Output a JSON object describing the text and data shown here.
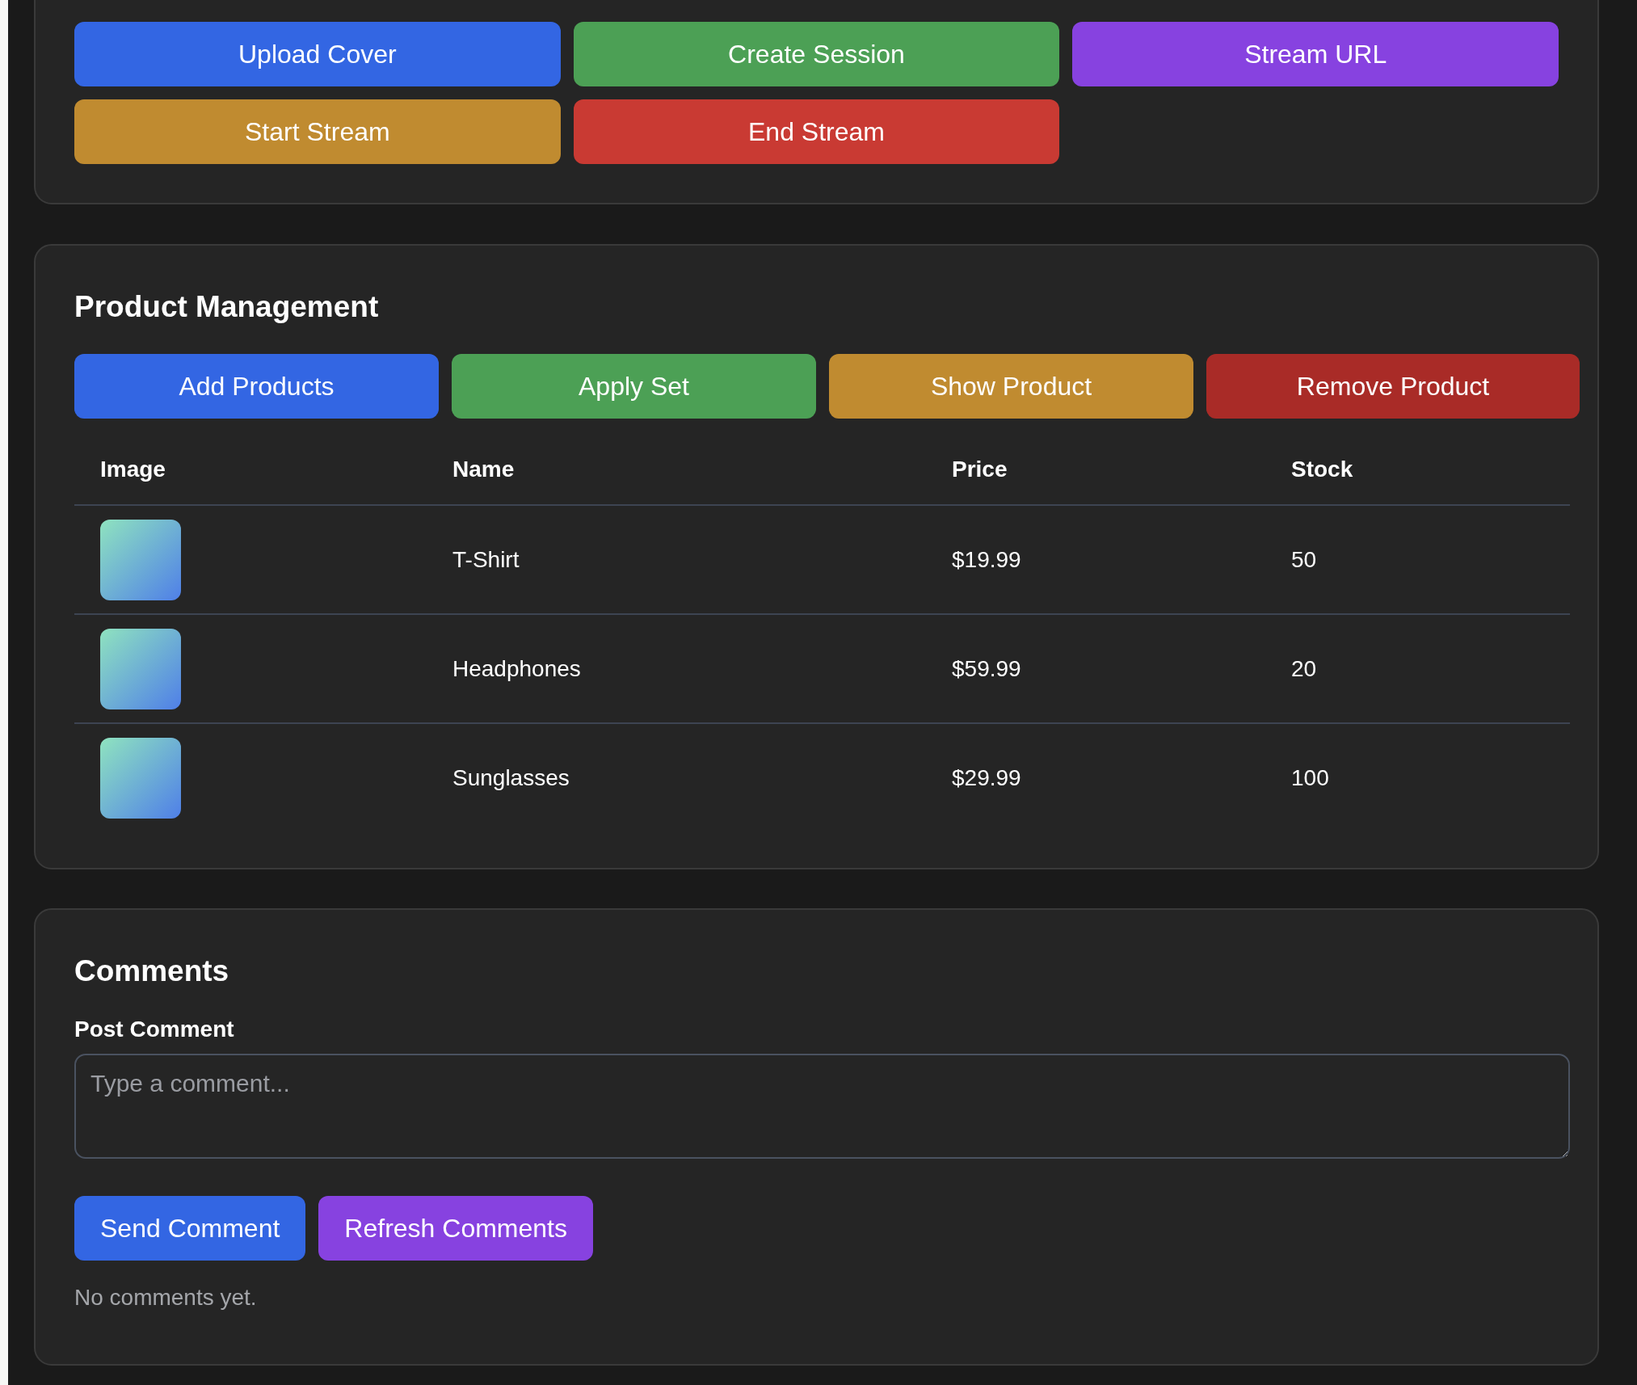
{
  "stream_controls": {
    "buttons": [
      {
        "label": "Upload Cover",
        "color": "#3366e3"
      },
      {
        "label": "Create Session",
        "color": "#4ca055"
      },
      {
        "label": "Stream URL",
        "color": "#8742e0"
      },
      {
        "label": "Start Stream",
        "color": "#c08b30"
      },
      {
        "label": "End Stream",
        "color": "#c93a33"
      }
    ]
  },
  "product_management": {
    "title": "Product Management",
    "buttons": [
      {
        "label": "Add Products",
        "color": "#3366e3"
      },
      {
        "label": "Apply Set",
        "color": "#4ca055"
      },
      {
        "label": "Show Product",
        "color": "#c08b30"
      },
      {
        "label": "Remove Product",
        "color": "#a92b27"
      }
    ],
    "table": {
      "columns": [
        "Image",
        "Name",
        "Price",
        "Stock"
      ],
      "rows": [
        {
          "name": "T-Shirt",
          "price": "$19.99",
          "stock": "50"
        },
        {
          "name": "Headphones",
          "price": "$59.99",
          "stock": "20"
        },
        {
          "name": "Sunglasses",
          "price": "$29.99",
          "stock": "100"
        }
      ]
    }
  },
  "comments": {
    "title": "Comments",
    "label": "Post Comment",
    "placeholder": "Type a comment...",
    "buttons": [
      {
        "label": "Send Comment",
        "color": "#3366e3"
      },
      {
        "label": "Refresh Comments",
        "color": "#8742e0"
      }
    ],
    "empty_text": "No comments yet."
  }
}
